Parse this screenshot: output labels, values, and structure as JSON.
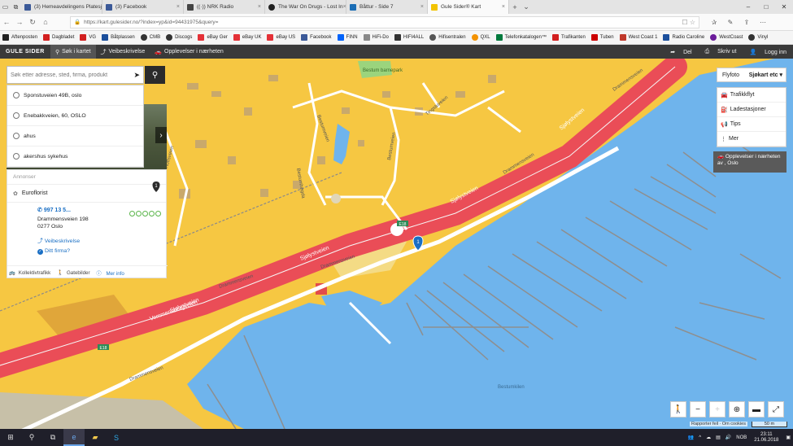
{
  "browser": {
    "tabs": [
      {
        "label": "(3) Hemeavdelingens Platesj",
        "color": "#3b5998"
      },
      {
        "label": "(3) Facebook",
        "color": "#3b5998"
      },
      {
        "label": "((·)) NRK Radio",
        "color": "#444444"
      },
      {
        "label": "The War On Drugs - Lost In",
        "color": "#222222"
      },
      {
        "label": "Båttur - Side 7",
        "color": "#1b6db5"
      },
      {
        "label": "Gule Sider® Kart",
        "color": "#f2c300"
      }
    ],
    "url": "https://kart.gulesider.no/?index=yp&id=94431975&query=",
    "bookmarks": [
      {
        "label": "Aftenposten",
        "color": "#222222"
      },
      {
        "label": "Dagbladet",
        "color": "#d21f1f"
      },
      {
        "label": "VG",
        "color": "#d21f1f"
      },
      {
        "label": "Båtplassen",
        "color": "#1b4f9c"
      },
      {
        "label": "CMB",
        "color": "#333333"
      },
      {
        "label": "Discogs",
        "color": "#333333"
      },
      {
        "label": "eBay Ger",
        "color": "#e43137"
      },
      {
        "label": "eBay UK",
        "color": "#e43137"
      },
      {
        "label": "eBay US",
        "color": "#e43137"
      },
      {
        "label": "Facebook",
        "color": "#3b5998"
      },
      {
        "label": "FINN",
        "color": "#0063fb"
      },
      {
        "label": "HiFi-Do",
        "color": "#888888"
      },
      {
        "label": "HIFI4ALL",
        "color": "#333333"
      },
      {
        "label": "Hifisentralen",
        "color": "#555555"
      },
      {
        "label": "QXL",
        "color": "#f39200"
      },
      {
        "label": "Telefonkatalogen™",
        "color": "#007a3d"
      },
      {
        "label": "Trafikanten",
        "color": "#d21f1f"
      },
      {
        "label": "Tuben",
        "color": "#cc0000"
      },
      {
        "label": "West Coast 1",
        "color": "#c0392b"
      },
      {
        "label": "Radio Caroline",
        "color": "#1b4f9c"
      },
      {
        "label": "WestCoast",
        "color": "#6a1b9a"
      },
      {
        "label": "Vinyl",
        "color": "#333333"
      }
    ]
  },
  "header": {
    "logo": "GULE SIDER",
    "nav": [
      "Søk i kartet",
      "Veibeskrivelse",
      "Opplevelser i nærheten"
    ],
    "share": "Del",
    "print": "Skriv ut",
    "login": "Logg inn"
  },
  "search": {
    "placeholder": "Søk etter adresse, sted, firma, produkt",
    "suggestions": [
      "Sponstuveien 49B, oslo",
      "Enebakkveien, 60, OSLO",
      "ahus",
      "akershus sykehus"
    ]
  },
  "infopanel": {
    "ads_label": "Annonser",
    "company": "Euroflorist",
    "phone": "997 13 5...",
    "address1": "Drammensveien 198",
    "address2": "0277 Oslo",
    "route": "Veibeskrivelse",
    "claim": "Ditt firma?",
    "links": [
      "Kollektivtrafikk",
      "Gatebilder",
      "Mer info"
    ],
    "pin": "1"
  },
  "layers": {
    "flyfoto": "Flyfoto",
    "current": "Sjøkart etc",
    "tools": [
      "Trafikkflyt",
      "Ladestasjoner",
      "Tips",
      "Mer"
    ],
    "experience": "Opplevelser i nærheten av , Oslo"
  },
  "map": {
    "road_labels": {
      "sjolyst1": "Sjølystveien",
      "sjolyst2": "Sjølystveien",
      "sjolyst3": "Sjølystveien",
      "drammens1": "Drammensveien",
      "drammens2": "Drammensveien",
      "drammens3": "Drammensveien",
      "drammens4": "Drammensveien",
      "drammens5": "Drammensveien",
      "vemmen": "Vemmensbergveien",
      "bestum": "Bestumveien",
      "bestumhogda": "Bestumhøgda",
      "tingstuveien": "Tingstuveien",
      "hoffsveien": "Hoffsveien",
      "bestumkilen": "Bestumkilen",
      "park": "Bestum barnepark"
    },
    "e18": "E18",
    "pin": "1",
    "colors": {
      "land": "#f6c742",
      "water": "#6fb4ec",
      "motorway": "#ea4d57",
      "road": "#ffffff",
      "park": "#9bd47d"
    }
  },
  "controls": {
    "attribution": "Rapporter feil · Om cookies",
    "scale": "50 m"
  },
  "taskbar": {
    "lang": "NOB",
    "time": "23:11",
    "date": "21.06.2018"
  }
}
